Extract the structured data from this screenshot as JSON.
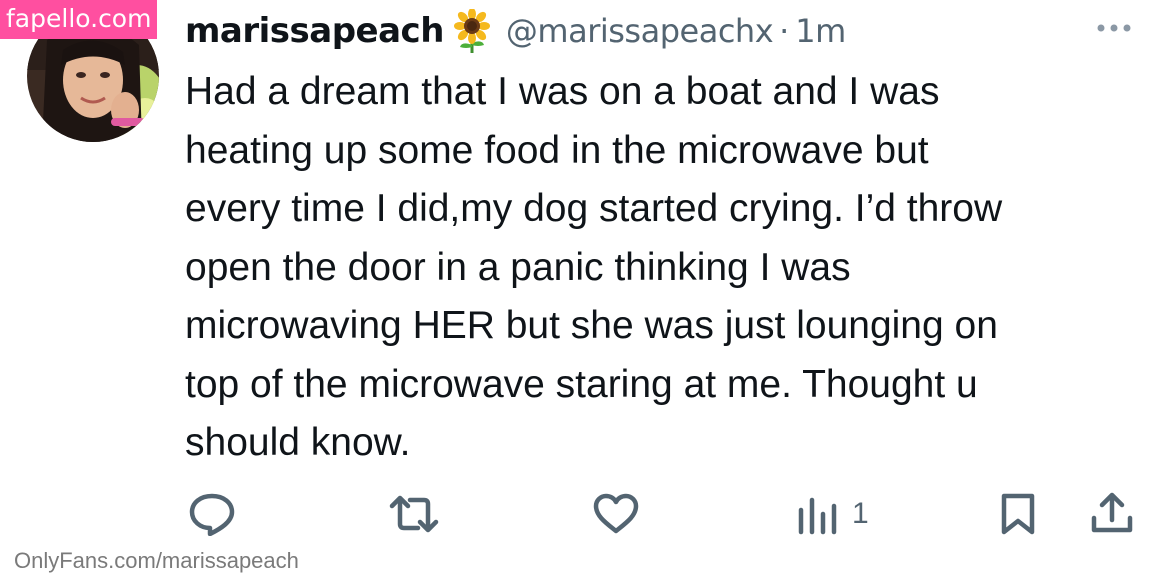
{
  "watermark_top": "fapello.com",
  "watermark_bottom": "OnlyFans.com/marissapeach",
  "tweet": {
    "display_name": "marissapeach",
    "name_emoji": "sunflower-icon",
    "handle": "@marissapeachx",
    "separator": "·",
    "time": "1m",
    "text": "Had a dream that I was on a boat and I was\nheating up some food in the microwave but\nevery time I did,my dog started crying. I’d throw\nopen the door in a panic thinking I was\nmicrowaving HER but she was just lounging on\ntop of the microwave staring at me. Thought u\nshould know.",
    "views": "1"
  },
  "icons": {
    "reply": "speech-bubble-icon",
    "retweet": "retweet-arrows-icon",
    "like": "heart-icon",
    "views": "bar-chart-icon",
    "bookmark": "bookmark-icon",
    "share": "share-upload-icon",
    "more": "more-dots-icon"
  },
  "colors": {
    "icon_gray": "#536471",
    "text": "#0f1419",
    "watermark_pink": "#ff4fa0"
  }
}
